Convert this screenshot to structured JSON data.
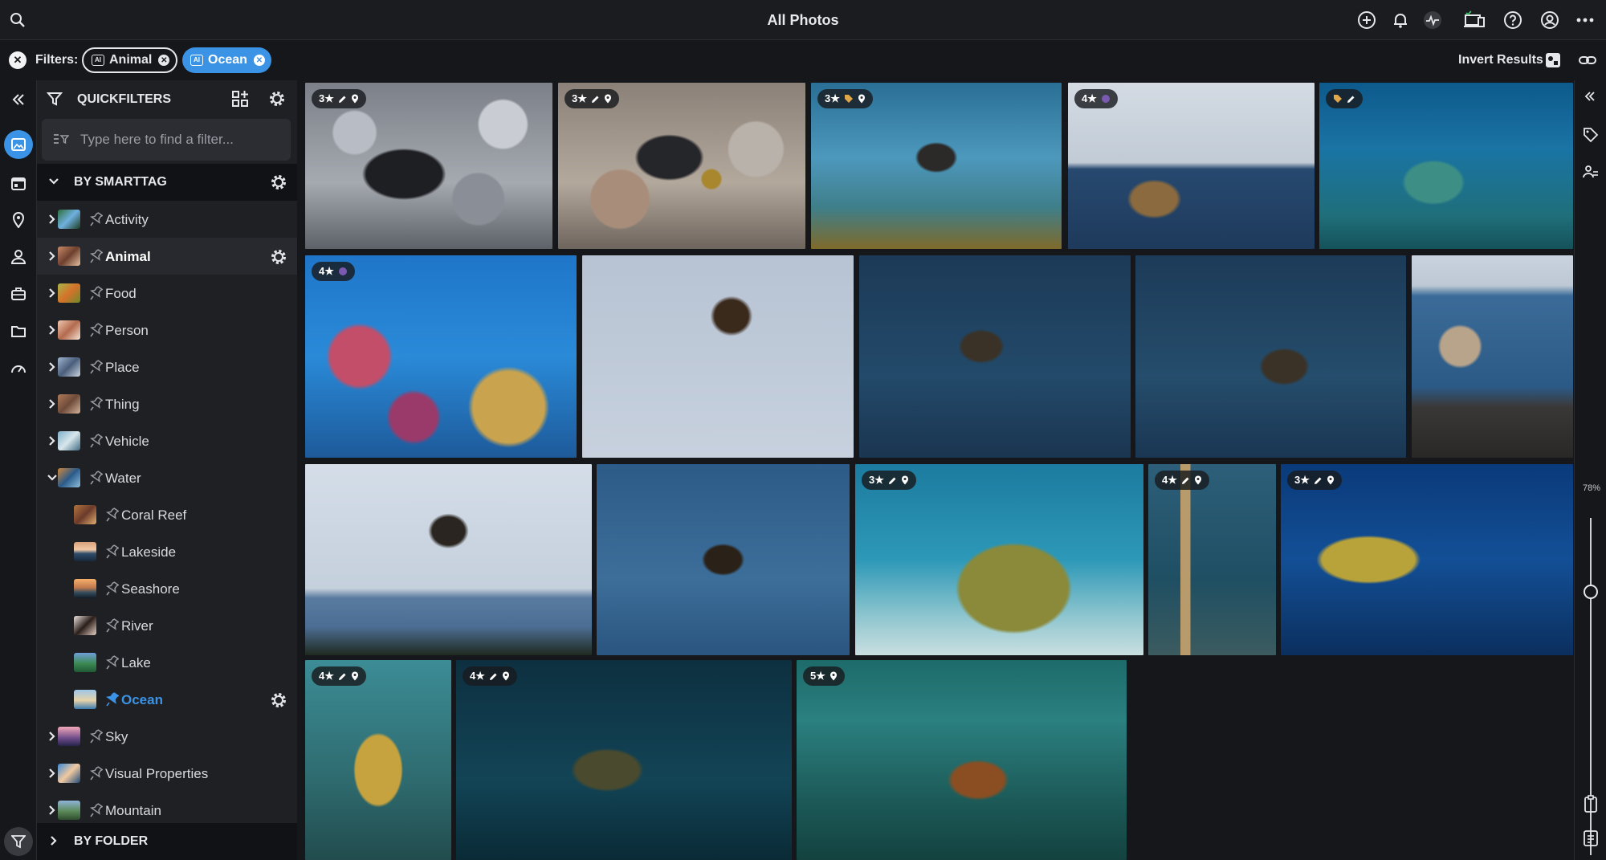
{
  "header": {
    "title": "All Photos",
    "icons": [
      "search-icon",
      "add-icon",
      "bell-icon",
      "activity-icon",
      "devices-icon",
      "help-icon",
      "account-icon",
      "more-icon"
    ]
  },
  "filters": {
    "label": "Filters:",
    "chips": [
      {
        "label": "Animal",
        "style": "outline"
      },
      {
        "label": "Ocean",
        "style": "active",
        "color": "#3b93e6"
      }
    ],
    "invert_label": "Invert Results"
  },
  "rail": {
    "icons": [
      "collapse-icon",
      "photos-icon",
      "calendar-icon",
      "location-icon",
      "person-icon",
      "work-icon",
      "folder-icon",
      "dashboard-icon",
      "filter-icon"
    ]
  },
  "quickfilters": {
    "title": "QUICKFILTERS",
    "search_placeholder": "Type here to find a filter...",
    "by_smarttag": "BY SMARTTAG",
    "by_folder": "BY FOLDER",
    "items": [
      {
        "label": "Activity",
        "expanded": false,
        "selected": false
      },
      {
        "label": "Animal",
        "expanded": false,
        "selected": true
      },
      {
        "label": "Food",
        "expanded": false,
        "selected": false
      },
      {
        "label": "Person",
        "expanded": false,
        "selected": false
      },
      {
        "label": "Place",
        "expanded": false,
        "selected": false
      },
      {
        "label": "Thing",
        "expanded": false,
        "selected": false
      },
      {
        "label": "Vehicle",
        "expanded": false,
        "selected": false
      },
      {
        "label": "Water",
        "expanded": true,
        "selected": false
      },
      {
        "label": "Coral Reef",
        "child": true
      },
      {
        "label": "Lakeside",
        "child": true
      },
      {
        "label": "Seashore",
        "child": true
      },
      {
        "label": "River",
        "child": true
      },
      {
        "label": "Lake",
        "child": true
      },
      {
        "label": "Ocean",
        "child": true,
        "active": true
      },
      {
        "label": "Sky",
        "expanded": false
      },
      {
        "label": "Visual Properties",
        "expanded": false
      },
      {
        "label": "Mountain",
        "expanded": false
      }
    ],
    "accent": "#3b93e6"
  },
  "photos": [
    {
      "rating": "3★",
      "icons": [
        "edit",
        "location"
      ]
    },
    {
      "rating": "3★",
      "icons": [
        "edit",
        "location"
      ]
    },
    {
      "rating": "3★",
      "icons": [
        "tag",
        "location"
      ]
    },
    {
      "rating": "4★",
      "icons": [
        "color-label"
      ]
    },
    {
      "rating": "",
      "icons": [
        "tag",
        "edit"
      ]
    },
    {
      "rating": "4★",
      "icons": [
        "color-label"
      ]
    },
    {
      "rating": "",
      "icons": []
    },
    {
      "rating": "",
      "icons": []
    },
    {
      "rating": "",
      "icons": []
    },
    {
      "rating": "",
      "icons": []
    },
    {
      "rating": "",
      "icons": []
    },
    {
      "rating": "",
      "icons": []
    },
    {
      "rating": "3★",
      "icons": [
        "edit",
        "location"
      ]
    },
    {
      "rating": "4★",
      "icons": [
        "edit",
        "location"
      ]
    },
    {
      "rating": "3★",
      "icons": [
        "edit",
        "location"
      ]
    },
    {
      "rating": "4★",
      "icons": [
        "edit",
        "location"
      ]
    },
    {
      "rating": "4★",
      "icons": [
        "edit",
        "location"
      ]
    },
    {
      "rating": "5★",
      "icons": [
        "location"
      ]
    }
  ],
  "zoom": {
    "value": "78%",
    "level": 0.78
  },
  "rightrail": {
    "icons": [
      "collapse-right-icon",
      "tag-icon",
      "people-icon",
      "clipboard-icon",
      "notes-icon"
    ]
  }
}
